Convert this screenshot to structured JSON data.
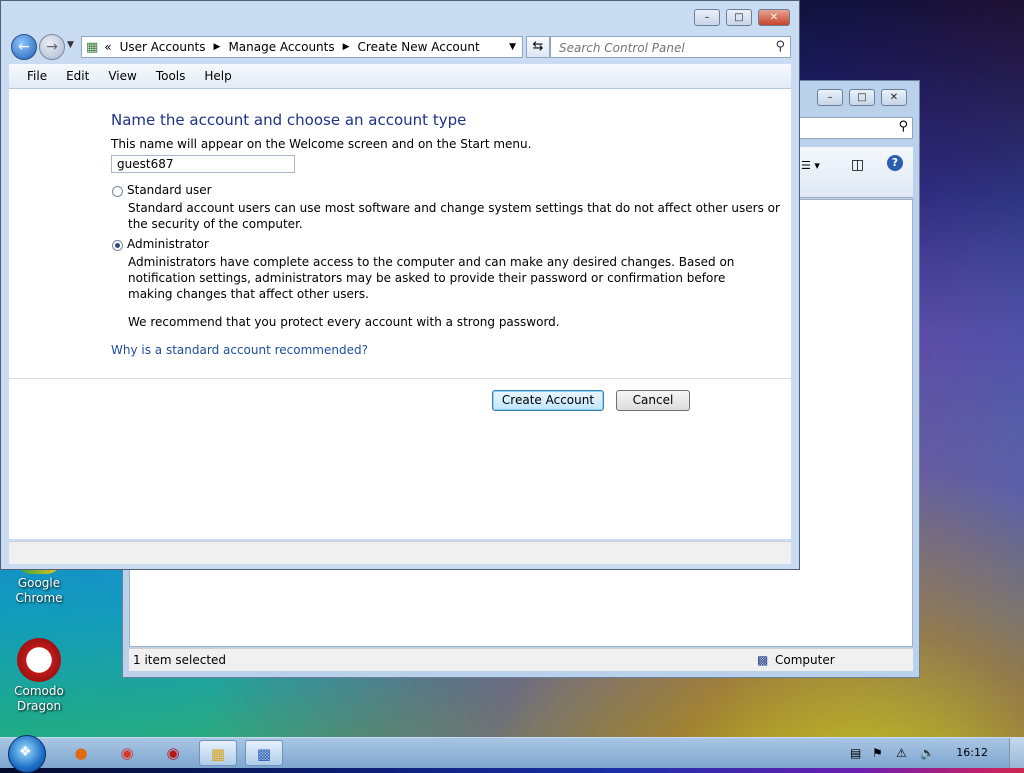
{
  "desktop": {
    "icons": [
      {
        "label": "Google Chrome"
      },
      {
        "label": "Comodo Dragon"
      }
    ]
  },
  "background_window": {
    "status_left": "1 item selected",
    "status_right": "Computer"
  },
  "window": {
    "breadcrumb": [
      "User Accounts",
      "Manage Accounts",
      "Create New Account"
    ],
    "breadcrumb_prefix": "«",
    "search_placeholder": "Search Control Panel",
    "menu": [
      "File",
      "Edit",
      "View",
      "Tools",
      "Help"
    ],
    "heading": "Name the account and choose an account type",
    "subtext": "This name will appear on the Welcome screen and on the Start menu.",
    "name_value": "guest687",
    "options": {
      "standard": {
        "label": "Standard user",
        "description_line1": "Standard account users can use most software and change system settings that do not affect other users or",
        "description_line2": "the security of the computer.",
        "selected": false
      },
      "admin": {
        "label": "Administrator",
        "description_line1": "Administrators have complete access to the computer and can make any desired changes. Based on",
        "description_line2": "notification settings, administrators may be asked to provide their password or confirmation before",
        "description_line3": "making changes that affect other users.",
        "selected": true
      }
    },
    "recommendation": "We recommend that you protect every account with a strong password.",
    "help_link": "Why is a standard account recommended?",
    "create_button": "Create Account",
    "cancel_button": "Cancel"
  },
  "taskbar": {
    "clock": "16:12"
  },
  "colors": {
    "heading": "#1e3287",
    "link": "#1e4fa1",
    "window_frame": "#c9dcf1"
  }
}
